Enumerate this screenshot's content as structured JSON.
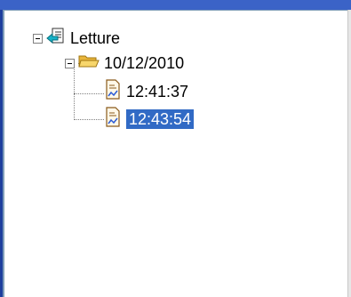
{
  "tree": {
    "root": {
      "label": "Letture",
      "icon": "data-source-icon",
      "expanded": true
    },
    "folder": {
      "label": "10/12/2010",
      "icon": "folder-open-icon",
      "expanded": true
    },
    "items": [
      {
        "label": "12:41:37",
        "icon": "document-chart-icon",
        "selected": false
      },
      {
        "label": "12:43:54",
        "icon": "document-chart-icon",
        "selected": true
      }
    ]
  },
  "colors": {
    "selection": "#316ac5",
    "title_bar": "#3b63c7",
    "folder": "#f3c64f"
  }
}
